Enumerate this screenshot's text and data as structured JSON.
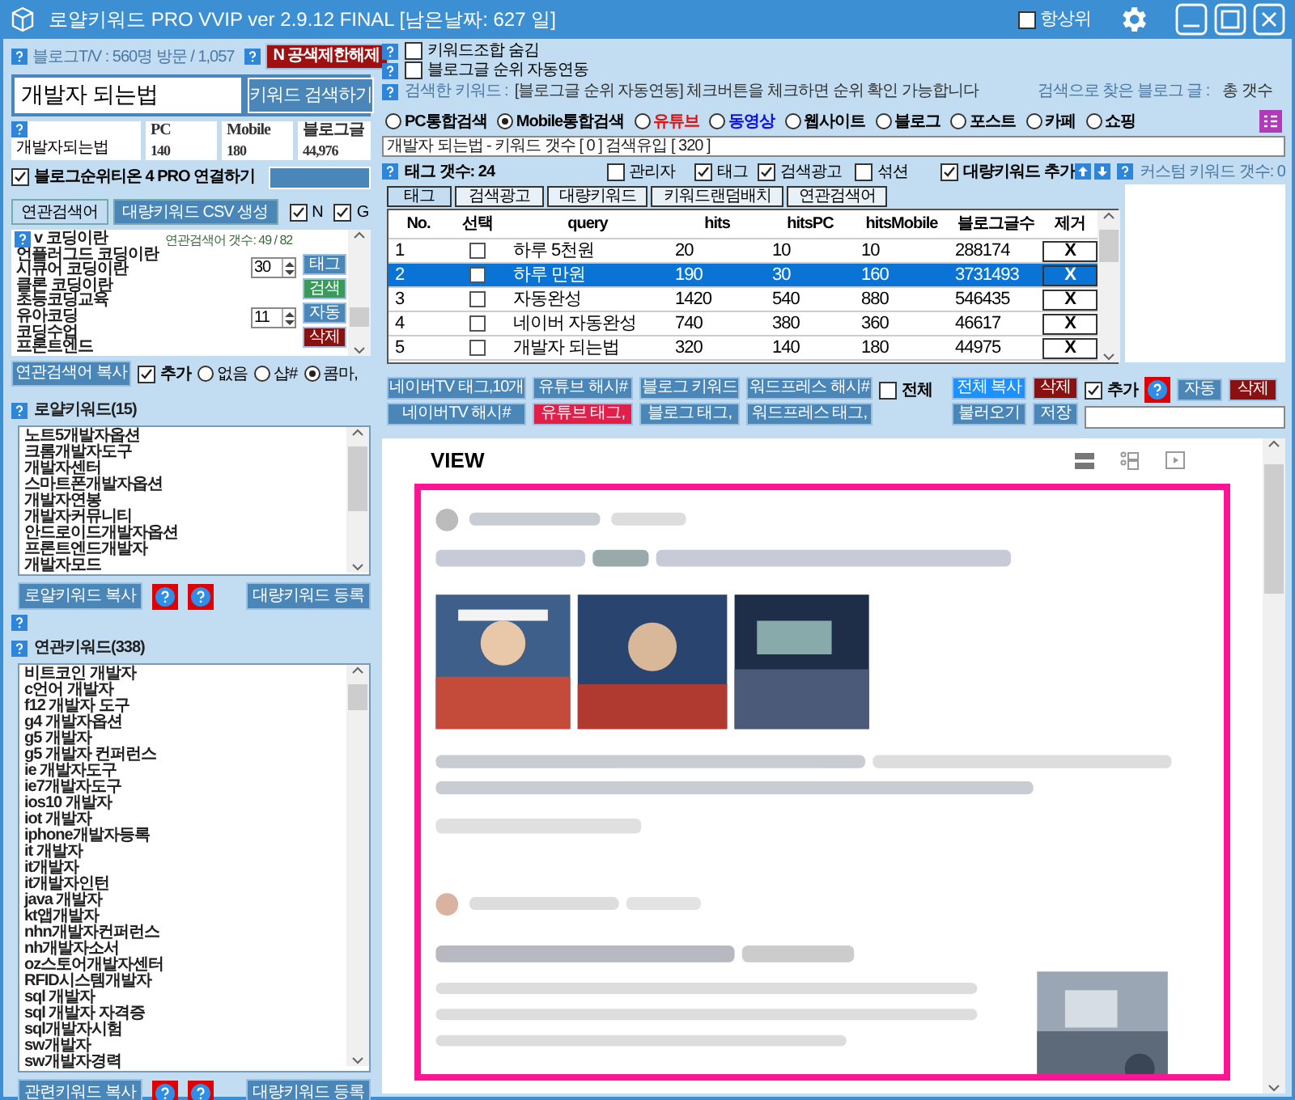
{
  "window": {
    "title": "로얄키워드 PRO VVIP ver 2.9.12 FINAL [남은날짜: 627 일]",
    "stay_on_top": {
      "label": "항상위",
      "checked": false
    }
  },
  "left": {
    "blog_tv": "블로그T/V : 560명 방문 / 1,057",
    "unlock_button": "N 공색제한해제",
    "keyword_input": {
      "value": "개발자 되는법"
    },
    "search_button": "키워드 검색하기",
    "stats": {
      "keyword": "개발자되는법",
      "columns": [
        {
          "header": "PC",
          "value": "140"
        },
        {
          "header": "Mobile",
          "value": "180"
        },
        {
          "header": "블로그글",
          "value": "44,976"
        }
      ]
    },
    "connect": {
      "label": "블로그순위티온 4 PRO 연결하기",
      "checked": true
    },
    "tabs": [
      {
        "label": "연관검색어",
        "selected": true
      },
      {
        "label": "대량키워드 CSV 생성",
        "selected": false
      }
    ],
    "source_checks": [
      {
        "label": "N",
        "checked": true
      },
      {
        "label": "G",
        "checked": true
      }
    ],
    "related_search": {
      "count": "연관검색어 갯수: 49 / 82",
      "items": [
        "v 코딩이란",
        "언플러그드 코딩이란",
        "시큐어 코딩이란",
        "클론 코딩이란",
        "초등코딩교육",
        "유아코딩",
        "코딩수업",
        "프론트엔드"
      ],
      "spinners": [
        "30",
        "11"
      ],
      "side_buttons": [
        {
          "label": "태그",
          "color": "#4a86b8"
        },
        {
          "label": "검색",
          "color": "#3a9a5a"
        },
        {
          "label": "자동",
          "color": "#4a86b8"
        },
        {
          "label": "삭제",
          "color": "#8b1010"
        }
      ]
    },
    "copy_button": "연관검색어 복사",
    "add_check": {
      "label": "추가",
      "checked": true
    },
    "separators": [
      {
        "label": "없음",
        "selected": false
      },
      {
        "label": "샵#",
        "selected": false
      },
      {
        "label": "콤마,",
        "selected": true
      }
    ],
    "royal": {
      "title": "로얄키워드(15)",
      "items": [
        "노트5개발자옵션",
        "크롬개발자도구",
        "개발자센터",
        "스마트폰개발자옵션",
        "개발자연봉",
        "개발자커뮤니티",
        "안드로이드개발자옵션",
        "프론트엔드개발자",
        "개발자모드"
      ],
      "copy_button": "로얄키워드 복사",
      "register_button": "대량키워드 등록"
    },
    "related": {
      "title": "연관키워드(338)",
      "items": [
        "비트코인 개발자",
        "c언어 개발자",
        "f12 개발자 도구",
        "g4 개발자옵션",
        "g5 개발자",
        "g5 개발자 컨퍼런스",
        "ie 개발자도구",
        "ie7개발자도구",
        "ios10 개발자",
        "iot 개발자",
        "iphone개발자등록",
        "it 개발자",
        "it개발자",
        "it개발자인턴",
        "java 개발자",
        "kt앱개발자",
        "nhn개발자컨퍼런스",
        "nh개발자소서",
        "oz스토어개발자센터",
        "RFID시스템개발자",
        "sql 개발자",
        "sql 개발자 자격증",
        "sql개발자시험",
        "sw개발자",
        "sw개발자경력"
      ],
      "copy_button": "관련키워드 복사",
      "register_button": "대량키워드 등록"
    }
  },
  "right": {
    "options": [
      {
        "label": "키워드조합 숨김",
        "checked": false
      },
      {
        "label": "블로그글 순위 자동연동",
        "checked": false
      }
    ],
    "searched_label": "검색한 키워드 :",
    "searched_message": "[블로그글 순위 자동연동] 체크버튼을 체크하면 순위 확인 가능합니다",
    "found_label": "검색으로 찾은 블로그 글 :",
    "found_total": "총 갯수",
    "search_types": [
      {
        "label": "PC통합검색",
        "selected": false,
        "color": "#000000"
      },
      {
        "label": "Mobile통합검색",
        "selected": true,
        "color": "#000000"
      },
      {
        "label": "유튜브",
        "selected": false,
        "color": "#e01010"
      },
      {
        "label": "동영상",
        "selected": false,
        "color": "#1010e0"
      },
      {
        "label": "웹사이트",
        "selected": false,
        "color": "#000000"
      },
      {
        "label": "블로그",
        "selected": false,
        "color": "#000000"
      },
      {
        "label": "포스트",
        "selected": false,
        "color": "#000000"
      },
      {
        "label": "카페",
        "selected": false,
        "color": "#000000"
      },
      {
        "label": "쇼핑",
        "selected": false,
        "color": "#000000"
      }
    ],
    "summary": "개발자 되는법 - 키워드 갯수 [ 0 ] 검색유입 [ 320 ]",
    "tag_count": "태그 갯수: 24",
    "tag_checks": [
      {
        "label": "관리자",
        "checked": false
      },
      {
        "label": "태그",
        "checked": true
      },
      {
        "label": "검색광고",
        "checked": true
      },
      {
        "label": "섞션",
        "checked": false
      },
      {
        "label": "대량키워드 추가",
        "checked": true
      }
    ],
    "custom_count": "커스텀 키워드 갯수: 0",
    "tabs": [
      {
        "label": "태그",
        "selected": true
      },
      {
        "label": "검색광고",
        "selected": false
      },
      {
        "label": "대량키워드",
        "selected": false
      },
      {
        "label": "키워드랜덤배치",
        "selected": false
      },
      {
        "label": "연관검색어",
        "selected": false
      }
    ],
    "table": {
      "columns": [
        "No.",
        "선택",
        "query",
        "hits",
        "hitsPC",
        "hitsMobile",
        "블로그글수",
        "제거"
      ],
      "rows": [
        {
          "no": "1",
          "checked": false,
          "query": "하루 5천원",
          "hits": "20",
          "hitsPC": "10",
          "hitsMobile": "10",
          "blog": "288174",
          "remove": "X",
          "selected": false
        },
        {
          "no": "2",
          "checked": false,
          "query": "하루 만원",
          "hits": "190",
          "hitsPC": "30",
          "hitsMobile": "160",
          "blog": "3731493",
          "remove": "X",
          "selected": true
        },
        {
          "no": "3",
          "checked": false,
          "query": "자동완성",
          "hits": "1420",
          "hitsPC": "540",
          "hitsMobile": "880",
          "blog": "546435",
          "remove": "X",
          "selected": false
        },
        {
          "no": "4",
          "checked": false,
          "query": "네이버 자동완성",
          "hits": "740",
          "hitsPC": "380",
          "hitsMobile": "360",
          "blog": "46617",
          "remove": "X",
          "selected": false
        },
        {
          "no": "5",
          "checked": false,
          "query": "개발자 되는법",
          "hits": "320",
          "hitsPC": "140",
          "hitsMobile": "180",
          "blog": "44975",
          "remove": "X",
          "selected": false
        }
      ]
    },
    "format_buttons": [
      [
        {
          "label": "네이버TV 태그,10개",
          "color": "#4a86b8"
        },
        {
          "label": "네이버TV 해시#",
          "color": "#4a86b8"
        }
      ],
      [
        {
          "label": "유튜브 해시#",
          "color": "#4a86b8"
        },
        {
          "label": "유튜브 태그,",
          "color": "#e0204a"
        }
      ],
      [
        {
          "label": "블로그 키워드",
          "color": "#4a86b8"
        },
        {
          "label": "블로그 태그,",
          "color": "#4a86b8"
        }
      ],
      [
        {
          "label": "워드프레스 해시#",
          "color": "#4a86b8"
        },
        {
          "label": "워드프레스 태그,",
          "color": "#4a86b8"
        }
      ]
    ],
    "all_check": {
      "label": "전체",
      "checked": false
    },
    "action_buttons": [
      [
        {
          "label": "전체 복사",
          "color": "#1e90ff"
        },
        {
          "label": "불러오기",
          "color": "#4a86b8"
        }
      ],
      [
        {
          "label": "삭제",
          "color": "#8b1010"
        },
        {
          "label": "저장",
          "color": "#4a86b8"
        }
      ]
    ],
    "add_check": {
      "label": "추가",
      "checked": true
    },
    "auto_button": "자동",
    "delete_button": "삭제",
    "view": {
      "title": "VIEW"
    }
  }
}
